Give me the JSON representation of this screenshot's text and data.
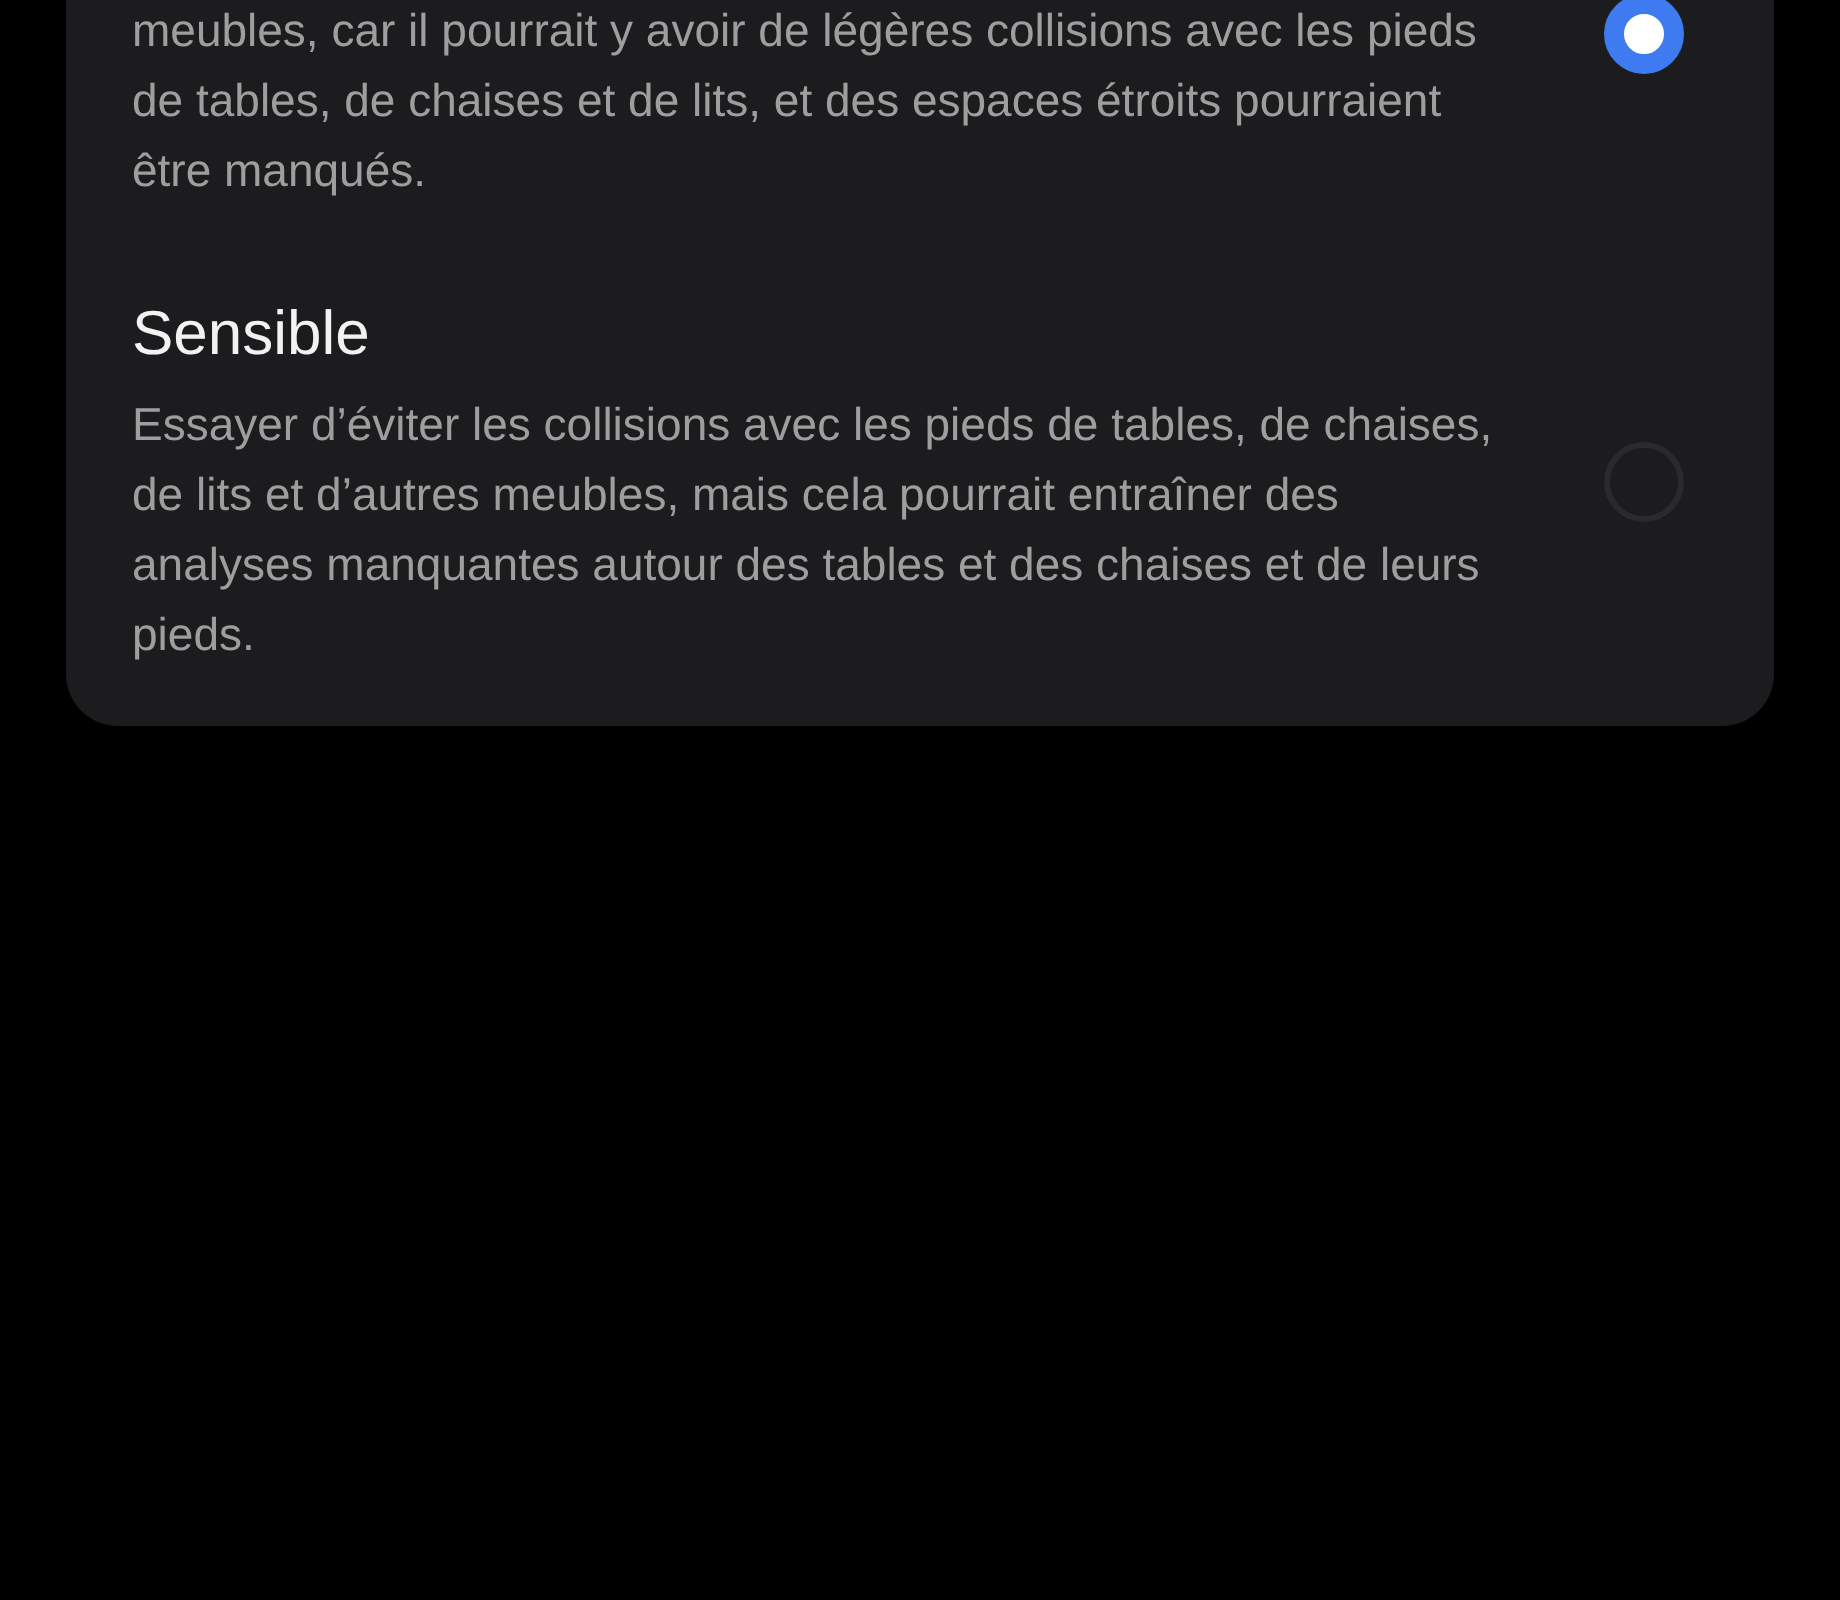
{
  "options": [
    {
      "description": "meubles, car il pourrait y avoir de légères collisions avec les pieds de tables, de chaises et de lits, et des espaces étroits pourraient être manqués.",
      "selected": true
    },
    {
      "title": "Sensible",
      "description": "Essayer d’éviter les collisions avec les pieds de tables, de chaises, de lits et d’autres meubles, mais cela pourrait entraîner des analyses manquantes autour des tables et des chaises et de leurs pieds.",
      "selected": false
    }
  ]
}
